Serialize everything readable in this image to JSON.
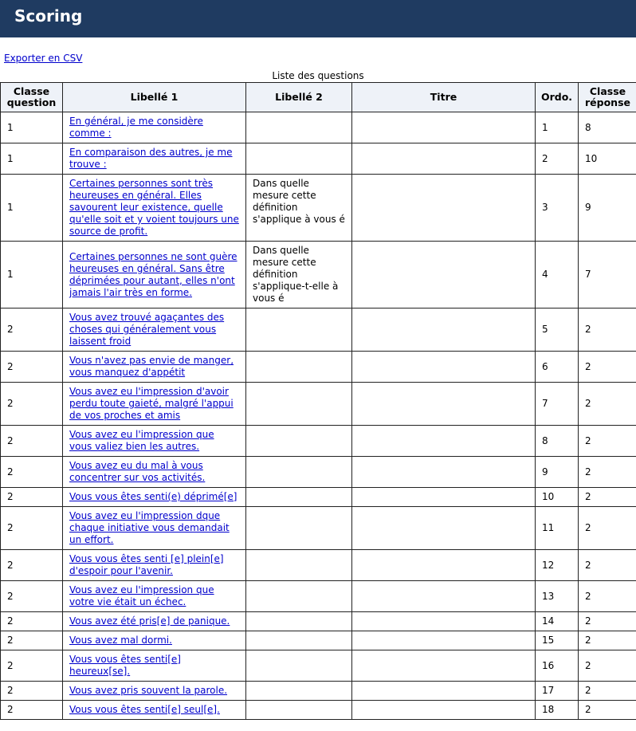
{
  "header": {
    "title": "Scoring"
  },
  "export_label": "Exporter en CSV",
  "caption": "Liste des questions",
  "columns": {
    "classe_question": "Classe question",
    "libelle1": "Libellé 1",
    "libelle2": "Libellé 2",
    "titre": "Titre",
    "ordo": "Ordo.",
    "classe_reponse": "Classe réponse"
  },
  "rows": [
    {
      "cq": "1",
      "l1": "En général, je me considère comme :",
      "l2": "",
      "t": "",
      "o": "1",
      "cr": "8"
    },
    {
      "cq": "1",
      "l1": "En comparaison des autres, je me trouve :",
      "l2": "",
      "t": "",
      "o": "2",
      "cr": "10"
    },
    {
      "cq": "1",
      "l1": "Certaines personnes sont très heureuses en général. Elles savourent leur existence, quelle qu'elle soit et y voient toujours une source de profit.",
      "l2": "Dans quelle mesure cette définition s'applique à vous é",
      "t": "",
      "o": "3",
      "cr": "9"
    },
    {
      "cq": "1",
      "l1": "Certaines personnes ne sont guère heureuses en général. Sans être déprimées pour autant, elles n'ont jamais l'air très en forme.",
      "l2": "Dans quelle mesure cette définition s'applique-t-elle à vous é",
      "t": "",
      "o": "4",
      "cr": "7"
    },
    {
      "cq": "2",
      "l1": "Vous avez trouvé agaçantes des choses qui généralement vous laissent froid",
      "l2": "",
      "t": "",
      "o": "5",
      "cr": "2"
    },
    {
      "cq": "2",
      "l1": "Vous n'avez pas envie de manger, vous manquez d'appétit",
      "l2": "",
      "t": "",
      "o": "6",
      "cr": "2"
    },
    {
      "cq": "2",
      "l1": "Vous avez eu l'impression d'avoir perdu toute gaieté, malgré l'appui de vos proches et amis",
      "l2": "",
      "t": "",
      "o": "7",
      "cr": "2"
    },
    {
      "cq": "2",
      "l1": "Vous avez eu l'impression que vous valiez bien les autres.",
      "l2": "",
      "t": "",
      "o": "8",
      "cr": "2"
    },
    {
      "cq": "2",
      "l1": "Vous avez eu du mal à vous concentrer sur vos activités.",
      "l2": "",
      "t": "",
      "o": "9",
      "cr": "2"
    },
    {
      "cq": "2",
      "l1": "Vous vous êtes senti(e) déprimé[e]",
      "l2": "",
      "t": "",
      "o": "10",
      "cr": "2"
    },
    {
      "cq": "2",
      "l1": "Vous avez eu l'impression dque chaque initiative vous demandait un effort.",
      "l2": "",
      "t": "",
      "o": "11",
      "cr": "2"
    },
    {
      "cq": "2",
      "l1": "Vous vous êtes senti [e] plein[e] d'espoir pour l'avenir.",
      "l2": "",
      "t": "",
      "o": "12",
      "cr": "2"
    },
    {
      "cq": "2",
      "l1": "Vous avez eu l'impression que votre vie était un échec.",
      "l2": "",
      "t": "",
      "o": "13",
      "cr": "2"
    },
    {
      "cq": "2",
      "l1": "Vous avez été pris[e] de panique.",
      "l2": "",
      "t": "",
      "o": "14",
      "cr": "2"
    },
    {
      "cq": "2",
      "l1": "Vous avez mal dormi.",
      "l2": "",
      "t": "",
      "o": "15",
      "cr": "2"
    },
    {
      "cq": "2",
      "l1": "Vous vous êtes senti[e] heureux[se].",
      "l2": "",
      "t": "",
      "o": "16",
      "cr": "2"
    },
    {
      "cq": "2",
      "l1": "Vous avez pris souvent la parole.",
      "l2": "",
      "t": "",
      "o": "17",
      "cr": "2"
    },
    {
      "cq": "2",
      "l1": "Vous vous êtes senti[e] seul[e].",
      "l2": "",
      "t": "",
      "o": "18",
      "cr": "2"
    }
  ]
}
